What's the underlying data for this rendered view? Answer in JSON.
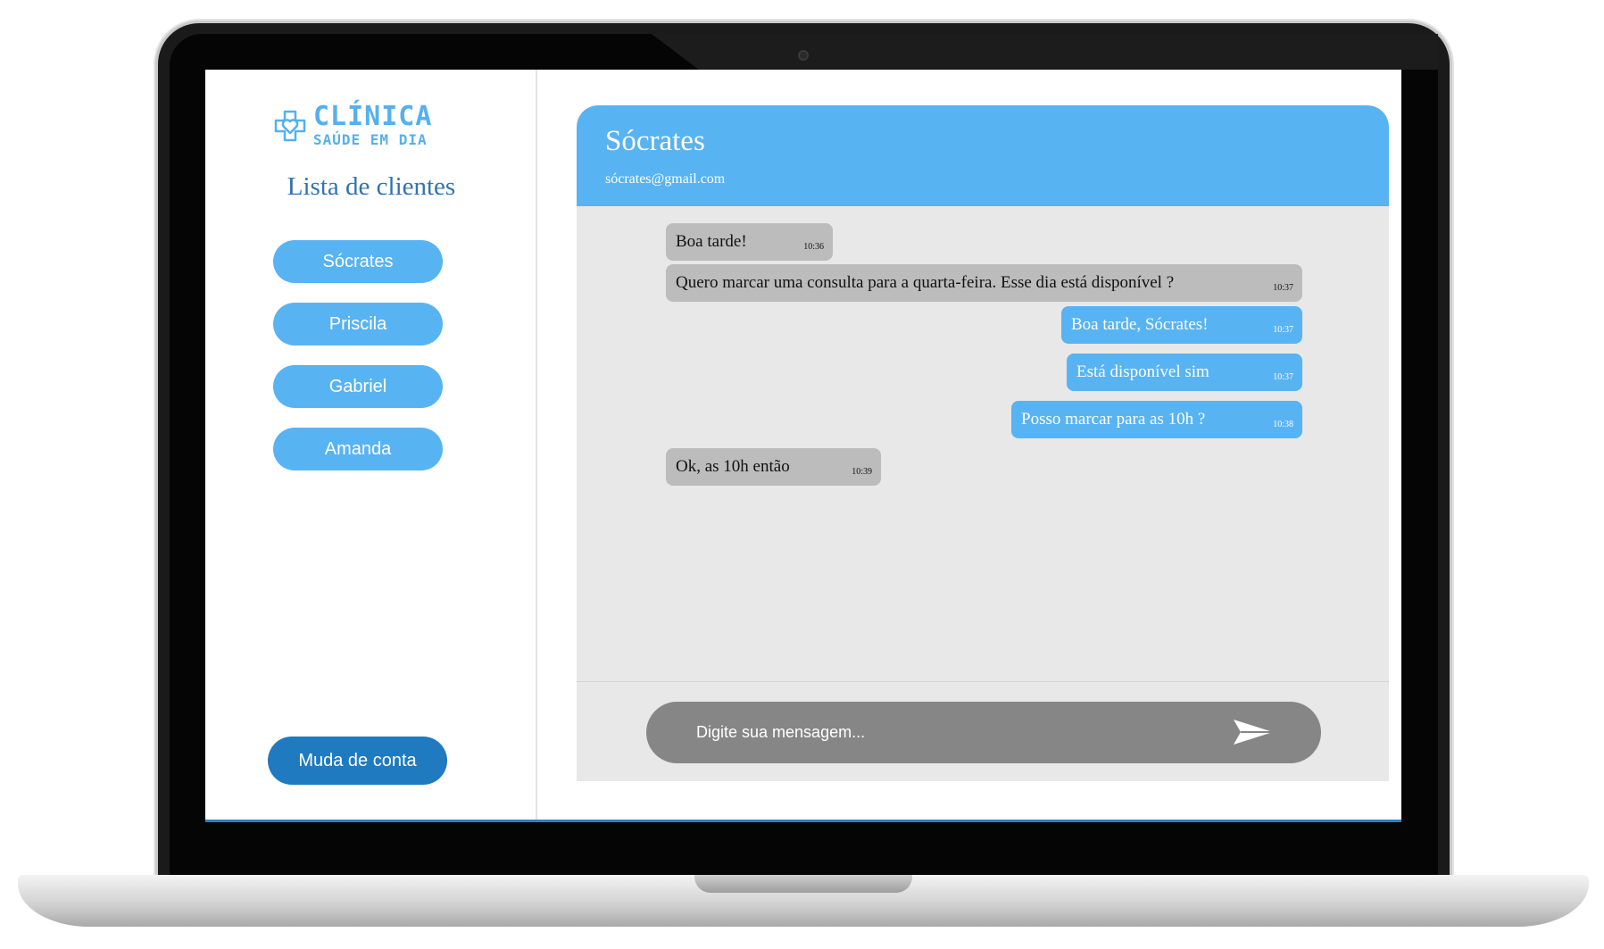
{
  "logo": {
    "title": "CLÍNICA",
    "subtitle": "SAÚDE EM DIA",
    "icon": "heart-cross-icon"
  },
  "sidebar": {
    "title": "Lista de clientes",
    "clients": [
      "Sócrates",
      "Priscila",
      "Gabriel",
      "Amanda"
    ],
    "switch_account_label": "Muda de conta"
  },
  "chat": {
    "contact_name": "Sócrates",
    "contact_email": "sócrates@gmail.com",
    "messages": [
      {
        "direction": "in",
        "text": "Boa tarde!",
        "time": "10:36"
      },
      {
        "direction": "in",
        "text": "Quero marcar uma consulta para a quarta-feira. Esse dia está disponível ?",
        "time": "10:37"
      },
      {
        "direction": "out",
        "text": "Boa tarde, Sócrates!",
        "time": "10:37"
      },
      {
        "direction": "out",
        "text": "Está disponível sim",
        "time": "10:37"
      },
      {
        "direction": "out",
        "text": "Posso marcar para as 10h ?",
        "time": "10:38"
      },
      {
        "direction": "in",
        "text": "Ok, as 10h então",
        "time": "10:39"
      }
    ],
    "input_placeholder": "Digite sua mensagem...",
    "send_icon": "send-icon"
  },
  "colors": {
    "accent": "#58b3f2",
    "dark_accent": "#1f7abf",
    "incoming_bubble": "#bcbcbc",
    "chat_background": "#e8e8e8",
    "composer": "#868686"
  }
}
